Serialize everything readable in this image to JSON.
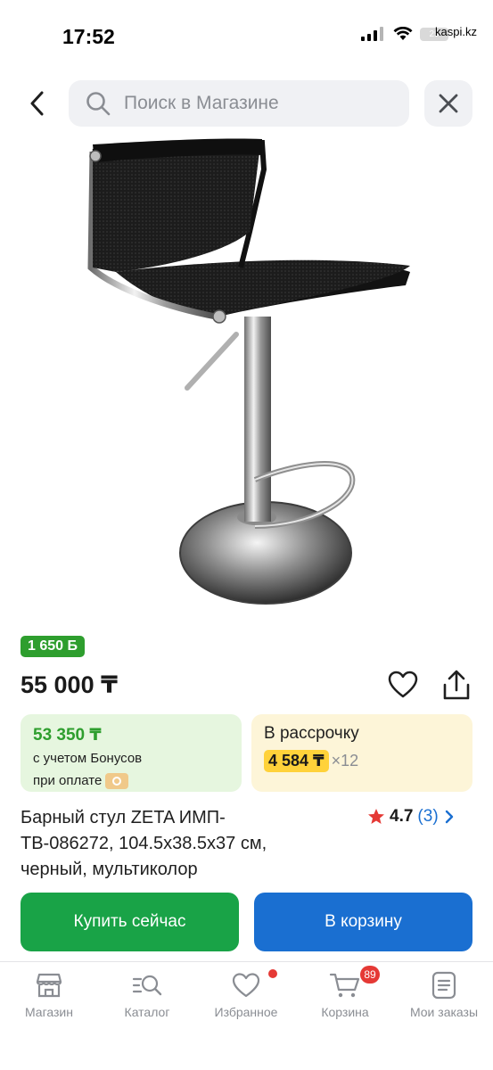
{
  "status_bar": {
    "time": "17:52",
    "battery": "29",
    "site": "kaspi.kz"
  },
  "header": {
    "search_placeholder": "Поиск в Магазине"
  },
  "product": {
    "bonus_badge": "1 650 Б",
    "price": "55 000 ₸",
    "bonus_card": {
      "amount": "53 350 ₸",
      "line1": "с учетом Бонусов",
      "line2": "при оплате"
    },
    "installment_card": {
      "title": "В рассрочку",
      "monthly": "4 584 ₸",
      "months": "×12"
    },
    "title_line1": "Барный стул ZETA ИМП-",
    "title_line2": "ТВ-086272, 104.5x38.5x37 см,",
    "title_line3": "черный, мультиколор",
    "rating": {
      "score": "4.7",
      "count": "(3)"
    }
  },
  "actions": {
    "buy_now": "Купить сейчас",
    "add_to_cart": "В корзину"
  },
  "bottom_nav": {
    "items": [
      {
        "label": "Магазин",
        "icon": "store-icon"
      },
      {
        "label": "Каталог",
        "icon": "catalog-search-icon"
      },
      {
        "label": "Избранное",
        "icon": "heart-icon"
      },
      {
        "label": "Корзина",
        "icon": "cart-icon"
      },
      {
        "label": "Мои заказы",
        "icon": "orders-icon"
      }
    ],
    "cart_badge": "89"
  },
  "colors": {
    "green": "#19a347",
    "blue": "#1a6fd1",
    "bonus_badge": "#2e9e2e",
    "installment_highlight": "#ffd23a",
    "badge_red": "#e53935"
  }
}
